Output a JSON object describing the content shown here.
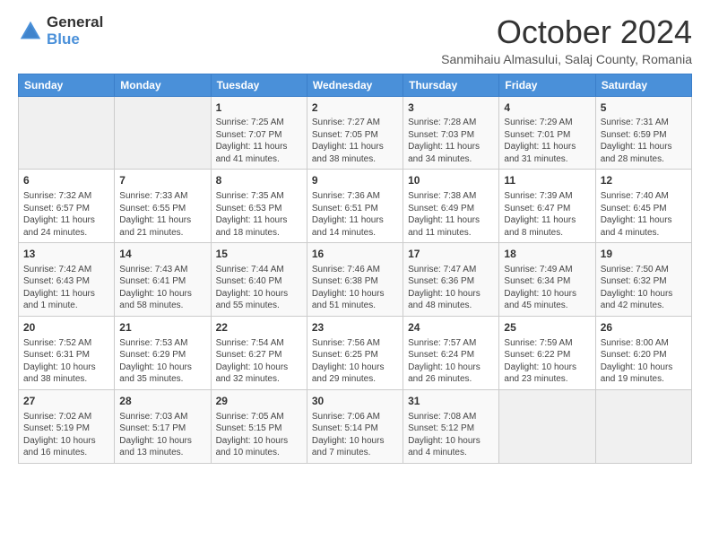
{
  "logo": {
    "general": "General",
    "blue": "Blue"
  },
  "title": "October 2024",
  "subtitle": "Sanmihaiu Almasului, Salaj County, Romania",
  "days_of_week": [
    "Sunday",
    "Monday",
    "Tuesday",
    "Wednesday",
    "Thursday",
    "Friday",
    "Saturday"
  ],
  "weeks": [
    [
      {
        "day": "",
        "info": ""
      },
      {
        "day": "",
        "info": ""
      },
      {
        "day": "1",
        "info": "Sunrise: 7:25 AM\nSunset: 7:07 PM\nDaylight: 11 hours and 41 minutes."
      },
      {
        "day": "2",
        "info": "Sunrise: 7:27 AM\nSunset: 7:05 PM\nDaylight: 11 hours and 38 minutes."
      },
      {
        "day": "3",
        "info": "Sunrise: 7:28 AM\nSunset: 7:03 PM\nDaylight: 11 hours and 34 minutes."
      },
      {
        "day": "4",
        "info": "Sunrise: 7:29 AM\nSunset: 7:01 PM\nDaylight: 11 hours and 31 minutes."
      },
      {
        "day": "5",
        "info": "Sunrise: 7:31 AM\nSunset: 6:59 PM\nDaylight: 11 hours and 28 minutes."
      }
    ],
    [
      {
        "day": "6",
        "info": "Sunrise: 7:32 AM\nSunset: 6:57 PM\nDaylight: 11 hours and 24 minutes."
      },
      {
        "day": "7",
        "info": "Sunrise: 7:33 AM\nSunset: 6:55 PM\nDaylight: 11 hours and 21 minutes."
      },
      {
        "day": "8",
        "info": "Sunrise: 7:35 AM\nSunset: 6:53 PM\nDaylight: 11 hours and 18 minutes."
      },
      {
        "day": "9",
        "info": "Sunrise: 7:36 AM\nSunset: 6:51 PM\nDaylight: 11 hours and 14 minutes."
      },
      {
        "day": "10",
        "info": "Sunrise: 7:38 AM\nSunset: 6:49 PM\nDaylight: 11 hours and 11 minutes."
      },
      {
        "day": "11",
        "info": "Sunrise: 7:39 AM\nSunset: 6:47 PM\nDaylight: 11 hours and 8 minutes."
      },
      {
        "day": "12",
        "info": "Sunrise: 7:40 AM\nSunset: 6:45 PM\nDaylight: 11 hours and 4 minutes."
      }
    ],
    [
      {
        "day": "13",
        "info": "Sunrise: 7:42 AM\nSunset: 6:43 PM\nDaylight: 11 hours and 1 minute."
      },
      {
        "day": "14",
        "info": "Sunrise: 7:43 AM\nSunset: 6:41 PM\nDaylight: 10 hours and 58 minutes."
      },
      {
        "day": "15",
        "info": "Sunrise: 7:44 AM\nSunset: 6:40 PM\nDaylight: 10 hours and 55 minutes."
      },
      {
        "day": "16",
        "info": "Sunrise: 7:46 AM\nSunset: 6:38 PM\nDaylight: 10 hours and 51 minutes."
      },
      {
        "day": "17",
        "info": "Sunrise: 7:47 AM\nSunset: 6:36 PM\nDaylight: 10 hours and 48 minutes."
      },
      {
        "day": "18",
        "info": "Sunrise: 7:49 AM\nSunset: 6:34 PM\nDaylight: 10 hours and 45 minutes."
      },
      {
        "day": "19",
        "info": "Sunrise: 7:50 AM\nSunset: 6:32 PM\nDaylight: 10 hours and 42 minutes."
      }
    ],
    [
      {
        "day": "20",
        "info": "Sunrise: 7:52 AM\nSunset: 6:31 PM\nDaylight: 10 hours and 38 minutes."
      },
      {
        "day": "21",
        "info": "Sunrise: 7:53 AM\nSunset: 6:29 PM\nDaylight: 10 hours and 35 minutes."
      },
      {
        "day": "22",
        "info": "Sunrise: 7:54 AM\nSunset: 6:27 PM\nDaylight: 10 hours and 32 minutes."
      },
      {
        "day": "23",
        "info": "Sunrise: 7:56 AM\nSunset: 6:25 PM\nDaylight: 10 hours and 29 minutes."
      },
      {
        "day": "24",
        "info": "Sunrise: 7:57 AM\nSunset: 6:24 PM\nDaylight: 10 hours and 26 minutes."
      },
      {
        "day": "25",
        "info": "Sunrise: 7:59 AM\nSunset: 6:22 PM\nDaylight: 10 hours and 23 minutes."
      },
      {
        "day": "26",
        "info": "Sunrise: 8:00 AM\nSunset: 6:20 PM\nDaylight: 10 hours and 19 minutes."
      }
    ],
    [
      {
        "day": "27",
        "info": "Sunrise: 7:02 AM\nSunset: 5:19 PM\nDaylight: 10 hours and 16 minutes."
      },
      {
        "day": "28",
        "info": "Sunrise: 7:03 AM\nSunset: 5:17 PM\nDaylight: 10 hours and 13 minutes."
      },
      {
        "day": "29",
        "info": "Sunrise: 7:05 AM\nSunset: 5:15 PM\nDaylight: 10 hours and 10 minutes."
      },
      {
        "day": "30",
        "info": "Sunrise: 7:06 AM\nSunset: 5:14 PM\nDaylight: 10 hours and 7 minutes."
      },
      {
        "day": "31",
        "info": "Sunrise: 7:08 AM\nSunset: 5:12 PM\nDaylight: 10 hours and 4 minutes."
      },
      {
        "day": "",
        "info": ""
      },
      {
        "day": "",
        "info": ""
      }
    ]
  ]
}
